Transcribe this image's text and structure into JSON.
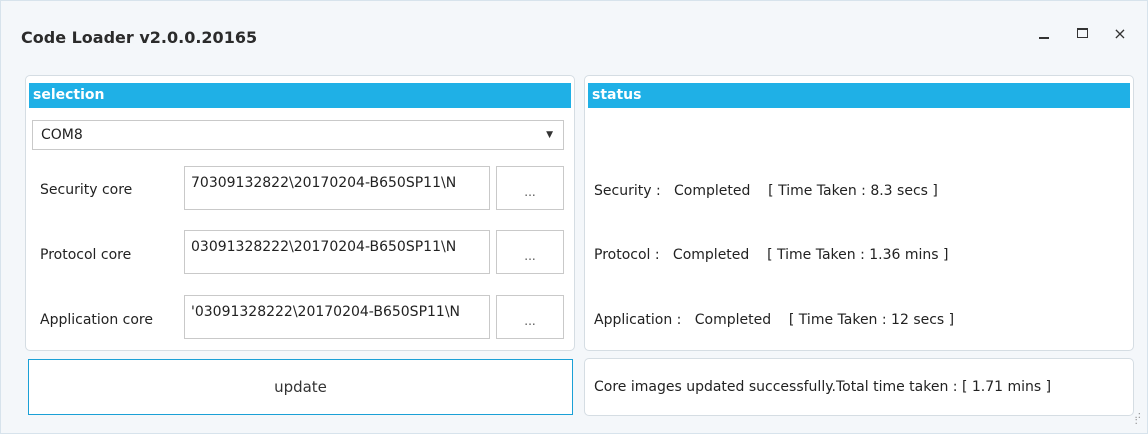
{
  "window": {
    "title": "Code Loader v2.0.0.20165",
    "minimize_icon": "minimize-icon",
    "maximize_icon": "maximize-icon",
    "close_glyph": "×"
  },
  "selection": {
    "header": "selection",
    "port": "COM8",
    "rows": [
      {
        "label": "Security core",
        "path": "70309132822\\20170204-B650SP11\\N",
        "browse": "..."
      },
      {
        "label": "Protocol core",
        "path": "03091328222\\20170204-B650SP11\\N",
        "browse": "..."
      },
      {
        "label": "Application core",
        "path": "'03091328222\\20170204-B650SP11\\N",
        "browse": "..."
      }
    ]
  },
  "status": {
    "header": "status",
    "lines": [
      "Security :   Completed    [ Time Taken : 8.3 secs ]",
      "Protocol :   Completed    [ Time Taken : 1.36 mins ]",
      "Application :   Completed    [ Time Taken : 12 secs ]"
    ]
  },
  "footer": {
    "update_label": "update",
    "summary": "Core images updated successfully.Total time taken : [ 1.71 mins ]"
  },
  "colors": {
    "accent": "#1fb0e6"
  }
}
